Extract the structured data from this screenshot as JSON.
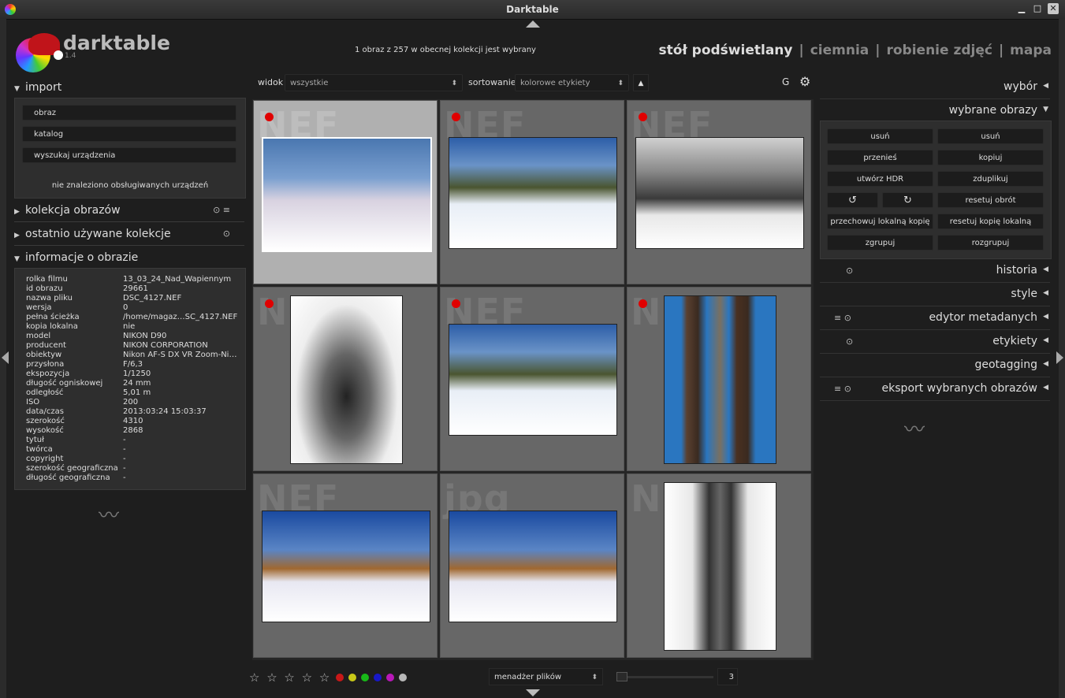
{
  "window": {
    "title": "Darktable"
  },
  "brand": {
    "name": "darktable",
    "version": "1.4"
  },
  "status_message": "1 obraz z 257 w obecnej kolekcji jest wybrany",
  "views": {
    "lighttable": "stół podświetlany",
    "darkroom": "ciemnia",
    "tethering": "robienie zdjęć",
    "map": "mapa",
    "separator": "|"
  },
  "import": {
    "header": "import",
    "buttons": [
      "obraz",
      "katalog",
      "wyszukaj urządzenia"
    ],
    "note": "nie znaleziono obsługiwanych urządzeń"
  },
  "collection": {
    "header": "kolekcja obrazów"
  },
  "recent": {
    "header": "ostatnio używane kolekcje"
  },
  "image_info": {
    "header": "informacje o obrazie",
    "rows": [
      {
        "k": "rolka filmu",
        "v": "13_03_24_Nad_Wapiennym"
      },
      {
        "k": "id obrazu",
        "v": "29661"
      },
      {
        "k": "nazwa pliku",
        "v": "DSC_4127.NEF"
      },
      {
        "k": "wersja",
        "v": "0"
      },
      {
        "k": "pełna ścieżka",
        "v": "/home/magaz…SC_4127.NEF"
      },
      {
        "k": "kopia lokalna",
        "v": "nie"
      },
      {
        "k": "model",
        "v": "NIKON D90"
      },
      {
        "k": "producent",
        "v": "NIKON CORPORATION"
      },
      {
        "k": "obiektyw",
        "v": "Nikon AF-S DX VR Zoom-Ni…"
      },
      {
        "k": "przysłona",
        "v": "F/6,3"
      },
      {
        "k": "ekspozycja",
        "v": "1/1250"
      },
      {
        "k": "długość ogniskowej",
        "v": "24 mm"
      },
      {
        "k": "odległość",
        "v": "5,01 m"
      },
      {
        "k": "ISO",
        "v": "200"
      },
      {
        "k": "data/czas",
        "v": "2013:03:24 15:03:37"
      },
      {
        "k": "szerokość",
        "v": "4310"
      },
      {
        "k": "wysokość",
        "v": "2868"
      },
      {
        "k": "tytuł",
        "v": "-"
      },
      {
        "k": "twórca",
        "v": "-"
      },
      {
        "k": "copyright",
        "v": "-"
      },
      {
        "k": "szerokość geograficzna",
        "v": "-"
      },
      {
        "k": "długość geograficzna",
        "v": "-"
      }
    ]
  },
  "toolbar": {
    "view_label": "widok",
    "view_value": "wszystkie",
    "sort_label": "sortowanie",
    "sort_value": "kolorowe etykiety",
    "sort_dir": "▲",
    "group_label": "G"
  },
  "thumbnails": [
    {
      "ext": "NEF",
      "label": "red",
      "selected": true
    },
    {
      "ext": "NEF",
      "label": "red"
    },
    {
      "ext": "NEF",
      "label": "red"
    },
    {
      "ext": "NEF",
      "label": "red"
    },
    {
      "ext": "NEF",
      "label": "red"
    },
    {
      "ext": "NEF",
      "label": "red"
    },
    {
      "ext": "NEF"
    },
    {
      "ext": "jpg"
    },
    {
      "ext": "NEF"
    }
  ],
  "right_panel": {
    "select": "wybór",
    "selected_images": "wybrane obrazy",
    "buttons": {
      "remove": "usuń",
      "delete": "usuń",
      "move": "przenieś",
      "copy": "kopiuj",
      "create_hdr": "utwórz HDR",
      "duplicate": "zduplikuj",
      "reset_rotation": "resetuj obrót",
      "keep_local": "przechowuj lokalną kopię",
      "reset_local": "resetuj kopię lokalną",
      "group": "zgrupuj",
      "ungroup": "rozgrupuj"
    },
    "history": "historia",
    "style": "style",
    "metadata": "edytor metadanych",
    "tags": "etykiety",
    "geotagging": "geotagging",
    "export": "eksport wybranych obrazów"
  },
  "bottom": {
    "stars": "☆ ☆ ☆ ☆ ☆",
    "color_labels": [
      "#c81818",
      "#c8c818",
      "#18b818",
      "#1818c8",
      "#b818b8",
      "#b8b8b8"
    ],
    "layout": "menadżer plików",
    "zoom": "3"
  }
}
